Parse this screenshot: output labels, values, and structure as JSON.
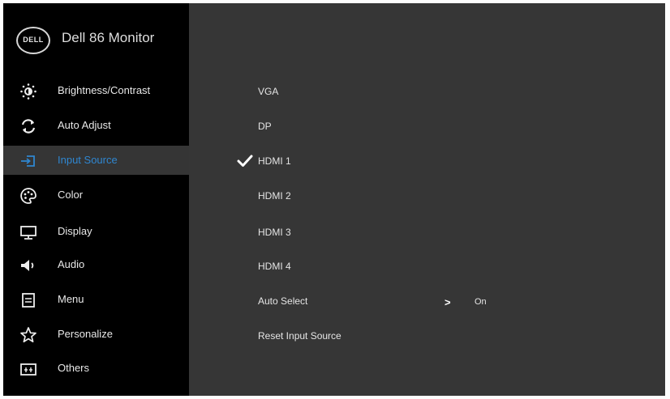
{
  "window": {
    "title": "Dell 86 Monitor",
    "logo_text": "DELL"
  },
  "sidebar": {
    "items": [
      {
        "label": "Brightness/Contrast",
        "icon": "brightness-icon"
      },
      {
        "label": "Auto Adjust",
        "icon": "auto-adjust-icon"
      },
      {
        "label": "Input Source",
        "icon": "input-source-icon",
        "active": true
      },
      {
        "label": "Color",
        "icon": "color-icon"
      },
      {
        "label": "Display",
        "icon": "display-icon"
      },
      {
        "label": "Audio",
        "icon": "audio-icon"
      },
      {
        "label": "Menu",
        "icon": "menu-icon"
      },
      {
        "label": "Personalize",
        "icon": "star-icon"
      },
      {
        "label": "Others",
        "icon": "others-icon"
      }
    ]
  },
  "input_source": {
    "options": [
      "VGA",
      "DP",
      "HDMI 1",
      "HDMI 2",
      "HDMI 3",
      "HDMI 4"
    ],
    "selected": "HDMI 1",
    "auto_select": {
      "label": "Auto Select",
      "value": "On"
    },
    "reset_label": "Reset Input Source"
  },
  "colors": {
    "accent": "#2f86d0",
    "sidebar_bg": "#000000",
    "panel_bg": "#363636"
  }
}
